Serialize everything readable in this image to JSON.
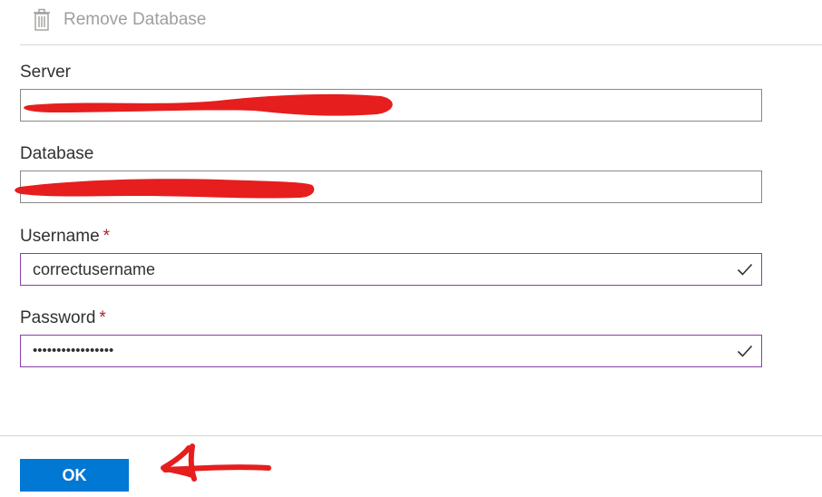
{
  "toolbar": {
    "remove_label": "Remove Database",
    "remove_icon": "trash-icon"
  },
  "form": {
    "server": {
      "label": "Server",
      "value": ""
    },
    "database": {
      "label": "Database",
      "value": ""
    },
    "username": {
      "label": "Username",
      "required_mark": "*",
      "value": "correctusername",
      "status_icon": "checkmark-icon"
    },
    "password": {
      "label": "Password",
      "required_mark": "*",
      "value": "•••••••••••••••••",
      "status_icon": "checkmark-icon"
    }
  },
  "footer": {
    "ok_label": "OK"
  },
  "colors": {
    "primary_button": "#0078d4",
    "required_mark": "#a4262c",
    "valid_border": "#8a3ea8",
    "redaction": "#e61e1e"
  }
}
